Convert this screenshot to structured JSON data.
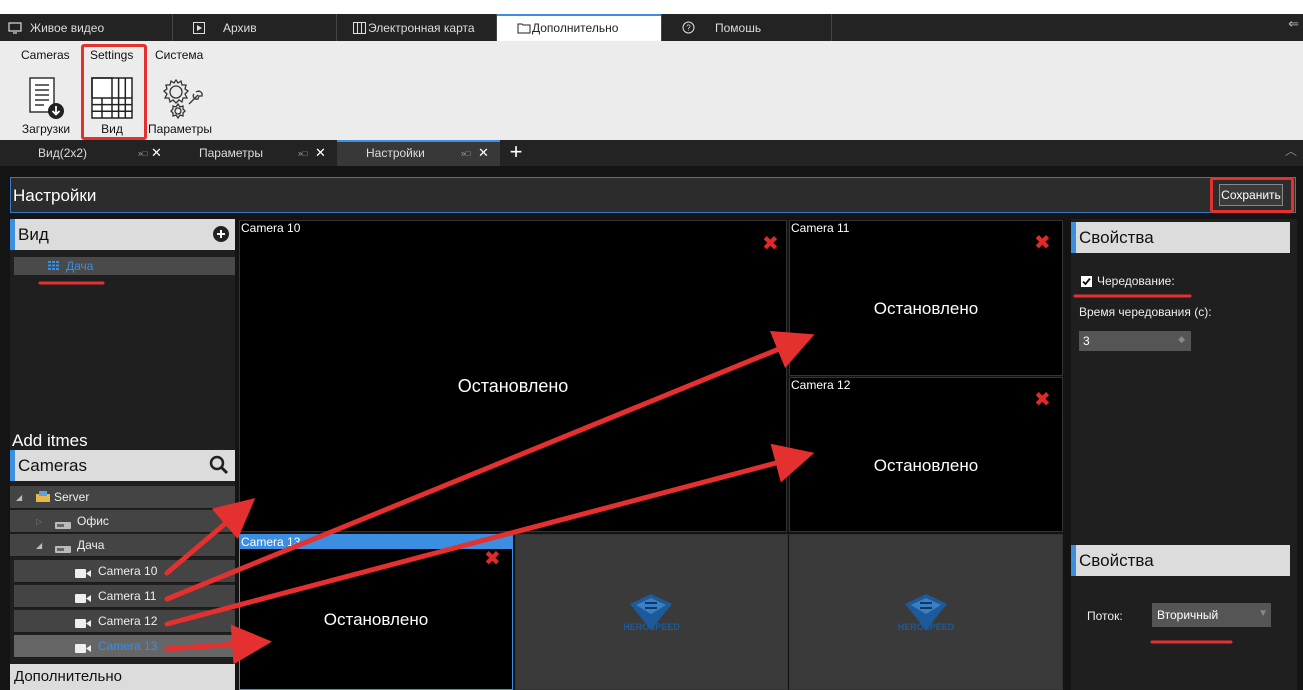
{
  "main_tabs": [
    {
      "label": "Живое видео",
      "icon": "monitor-icon"
    },
    {
      "label": "Архив",
      "icon": "play-icon"
    },
    {
      "label": "Электронная карта",
      "icon": "map-icon"
    },
    {
      "label": "Дополнительно",
      "icon": "folder-icon",
      "active": true
    },
    {
      "label": "Помошь",
      "icon": "help-icon"
    }
  ],
  "ribbon": {
    "tabs": [
      "Cameras",
      "Settings",
      "Система"
    ],
    "buttons": [
      {
        "label": "Загрузки",
        "icon": "download-list-icon"
      },
      {
        "label": "Вид",
        "icon": "grid-view-icon"
      },
      {
        "label": "Параметры",
        "icon": "gears-icon"
      }
    ]
  },
  "sub_tabs": [
    {
      "label": "Вид(2x2)"
    },
    {
      "label": "Параметры"
    },
    {
      "label": "Настройки",
      "active": true
    }
  ],
  "settings": {
    "title": "Настройки",
    "save_label": "Сохранить"
  },
  "left_panel": {
    "view_header": "Вид",
    "view_items": [
      "Дача"
    ],
    "add_items_label": "Add itmes",
    "cameras_header": "Cameras",
    "tree": [
      {
        "label": "Server",
        "level": 0,
        "icon": "server-icon",
        "expander": "expanded"
      },
      {
        "label": "Офис",
        "level": 1,
        "icon": "dvr-icon",
        "expander": "collapsed"
      },
      {
        "label": "Дача",
        "level": 1,
        "icon": "dvr-icon",
        "expander": "expanded"
      },
      {
        "label": "Camera 10",
        "level": 2,
        "icon": "camera-icon"
      },
      {
        "label": "Camera 11",
        "level": 2,
        "icon": "camera-icon"
      },
      {
        "label": "Camera 12",
        "level": 2,
        "icon": "camera-icon"
      },
      {
        "label": "Camera 13",
        "level": 2,
        "icon": "camera-icon",
        "selected": true
      }
    ],
    "additional_label": "Дополнительно"
  },
  "grid": {
    "cells": [
      {
        "camera": "Camera 10",
        "status": "Остановлено"
      },
      {
        "camera": "Camera 11",
        "status": "Остановлено"
      },
      {
        "camera": "Camera 12",
        "status": "Остановлено"
      },
      {
        "camera": "Camera 13",
        "status": "Остановлено"
      }
    ],
    "empty_logo_text": "HEROSPEED"
  },
  "right_panel": {
    "properties_header": "Свойства",
    "rotation_label": "Чередование:",
    "rotation_checked": true,
    "rotation_time_label": "Время чередования (с):",
    "rotation_time_value": "3",
    "properties_header_2": "Свойства",
    "stream_label": "Поток:",
    "stream_value": "Вторичный"
  },
  "colors": {
    "accent": "#3b8ee0",
    "annotation_red": "#e53030",
    "close_red": "#e02929"
  }
}
